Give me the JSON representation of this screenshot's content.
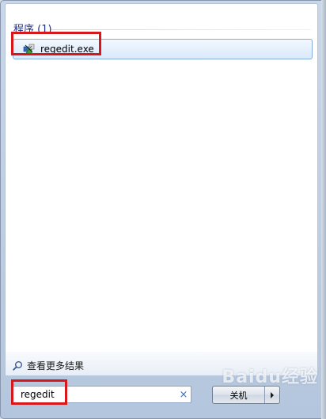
{
  "results": {
    "section_title": "程序 (1)",
    "items": [
      {
        "label": "regedit.exe",
        "icon": "regedit-icon"
      }
    ]
  },
  "more_results": {
    "label": "查看更多结果",
    "icon": "search-icon"
  },
  "search": {
    "value": "regedit",
    "clear_symbol": "×"
  },
  "shutdown": {
    "label": "关机",
    "arrow": "▸"
  },
  "watermark": {
    "text": "Baidu经验"
  },
  "colors": {
    "highlight": "#d8171b",
    "section_title": "#1e3287",
    "selection_border": "#84acdd"
  }
}
